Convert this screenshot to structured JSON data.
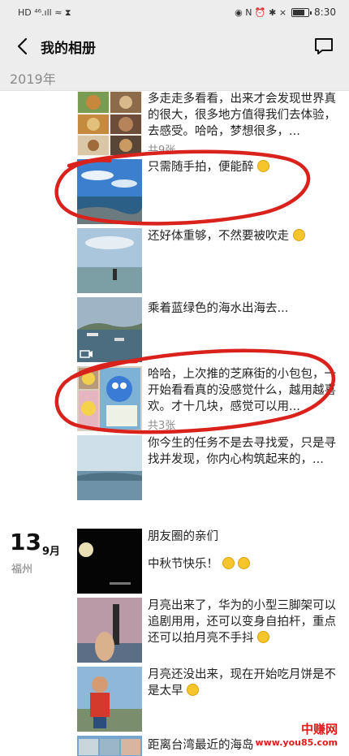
{
  "status_bar": {
    "left_glyphs": "HD ⁴⁶.ıll ≈ ⧗",
    "right_glyphs": "◉ N ⏰ ✱ ⨯",
    "time": "8:30"
  },
  "header": {
    "title": "我的相册"
  },
  "year_label": "2019年",
  "posts": [
    {
      "text": "多走走多看看，出来才会发现世界真的很大，很多地方值得我们去体验，去感受。哈哈，梦想很多，...",
      "count": "共9张"
    },
    {
      "text": "只需随手拍，便能醉"
    },
    {
      "text": "还好体重够，不然要被吹走"
    },
    {
      "text": "乘着蓝绿色的海水出海去..."
    },
    {
      "text": "哈哈，上次推的芝麻街的小包包，一开始看看真的没感觉什么，越用越喜欢。才十几块，感觉可以用...",
      "count": "共3张"
    },
    {
      "text": "你今生的任务不是去寻找爱，只是寻找并发现，你内心构筑起来的，..."
    }
  ],
  "date_group": {
    "day": "13",
    "month": "9月",
    "location": "福州"
  },
  "posts_sep13": [
    {
      "line1": "朋友圈的亲们",
      "line2": "中秋节快乐！"
    },
    {
      "text": "月亮出来了，华为的小型三脚架可以追剧用用，还可以变身自拍杆，重点还可以拍月亮不手抖"
    },
    {
      "text": "月亮还没出来，现在开始吃月饼是不是太早"
    },
    {
      "text": "距离台湾最近的海岛"
    }
  ],
  "watermark": {
    "title": "中赚网",
    "url": "www.you85.com"
  },
  "colors": {
    "bar_bg": "#ededed",
    "annotation_red": "#d9221c",
    "watermark_red": "#e21b1b"
  }
}
